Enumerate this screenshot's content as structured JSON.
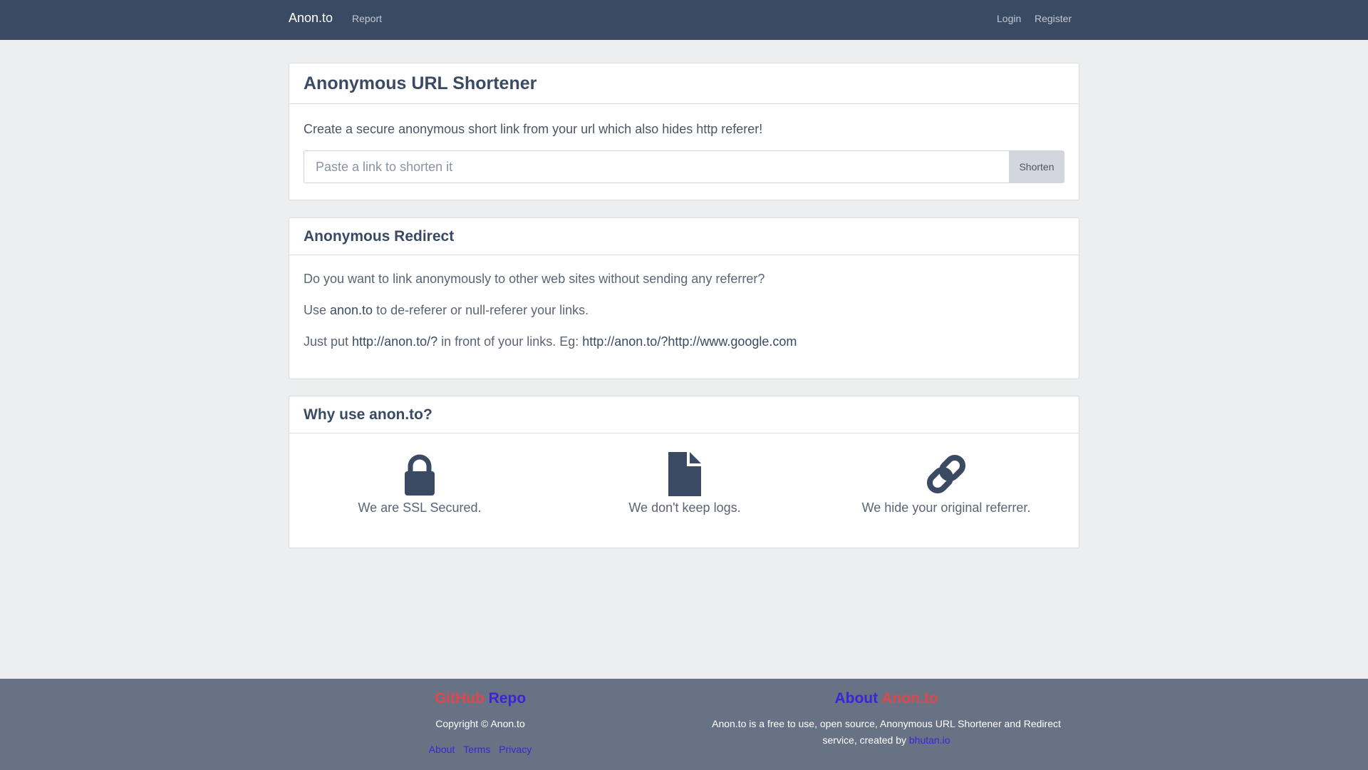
{
  "navbar": {
    "brand": "Anon.to",
    "report": "Report",
    "login": "Login",
    "register": "Register"
  },
  "shortener": {
    "title": "Anonymous URL Shortener",
    "lead": "Create a secure anonymous short link from your url which also hides http referer!",
    "placeholder": "Paste a link to shorten it",
    "value": "",
    "button": "Shorten"
  },
  "redirect": {
    "title": "Anonymous Redirect",
    "line1": "Do you want to link anonymously to other web sites without sending any referrer?",
    "line2_pre": "Use ",
    "line2_hl": "anon.to",
    "line2_post": " to de-referer or null-referer your links.",
    "line3_pre": "Just put ",
    "line3_hl1": "http://anon.to/?",
    "line3_mid": " in front of your links. Eg: ",
    "line3_hl2": "http://anon.to/?http://www.google.com"
  },
  "why": {
    "title": "Why use anon.to?",
    "features": [
      {
        "icon": "lock-icon",
        "text": "We are SSL Secured."
      },
      {
        "icon": "file-icon",
        "text": "We don't keep logs."
      },
      {
        "icon": "link-icon",
        "text": "We hide your original referrer."
      }
    ]
  },
  "footer": {
    "left": {
      "heading_part1": "GitHub",
      "heading_part2": "Repo",
      "copyright": "Copyright © Anon.to",
      "links": [
        "About",
        "Terms",
        "Privacy"
      ]
    },
    "right": {
      "heading_part1": "About",
      "heading_part2": "Anon.to",
      "text_line1": "Anon.to is a free to use, open source, Anonymous URL Shortener and Redirect",
      "text_line2": "service, created by ",
      "creator": "bhutan.io"
    }
  },
  "colors": {
    "navbar": "#3b4a63",
    "background": "#eceef0",
    "footer": "#677384",
    "accent_red": "#e0474c",
    "accent_blue": "#3b25d6"
  }
}
